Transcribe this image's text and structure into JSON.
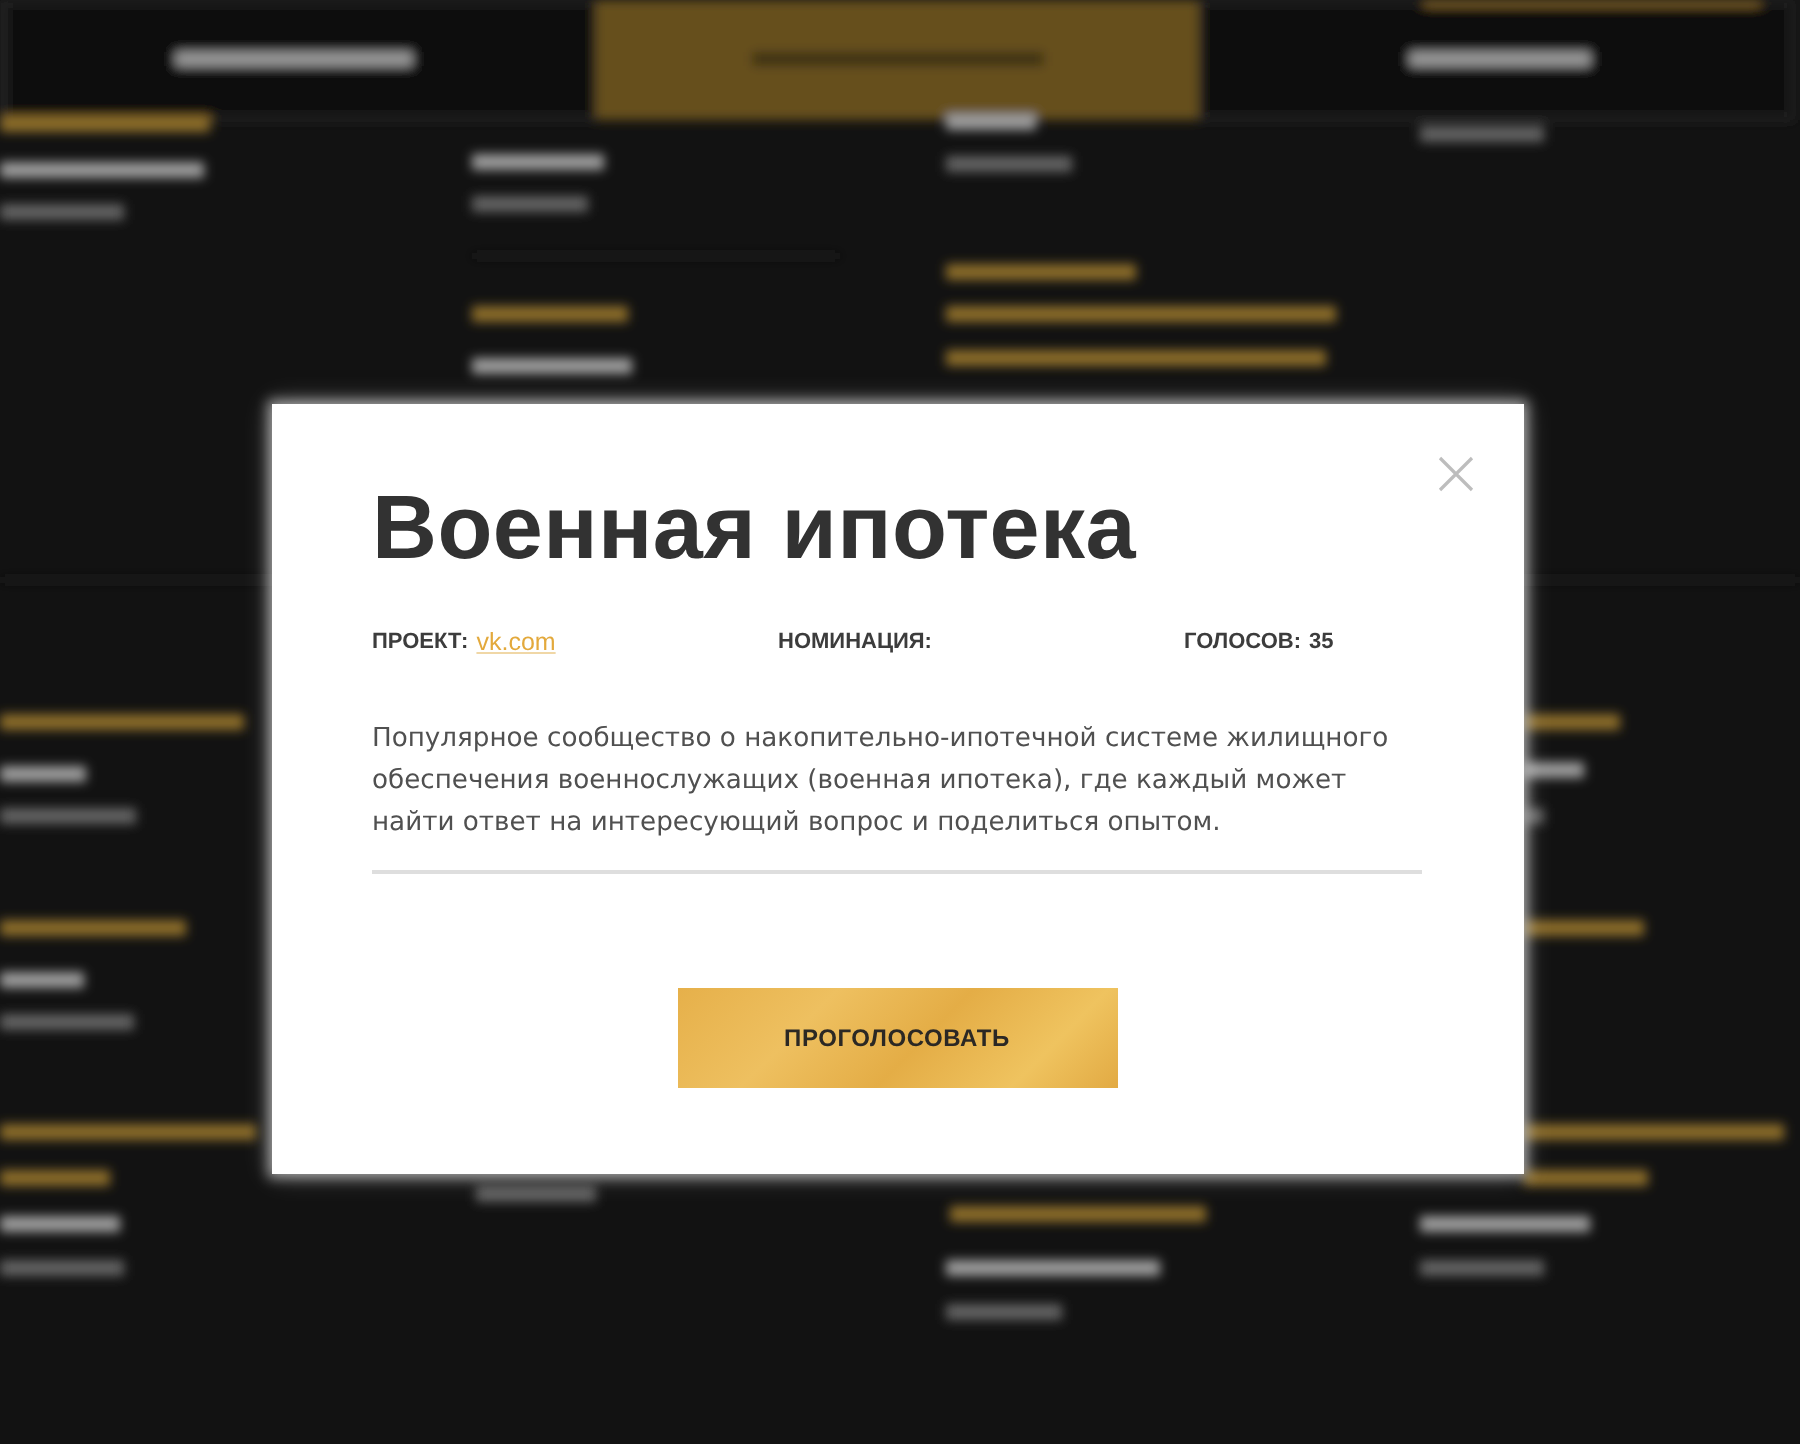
{
  "modal": {
    "title": "Военная ипотека",
    "meta": [
      {
        "kind": "link",
        "label": "ПРОЕКТ:",
        "value": "vk.com"
      },
      {
        "kind": "text",
        "label": "НОМИНАЦИЯ:"
      },
      {
        "kind": "text",
        "label": "ГОЛОСОВ:",
        "value": "35"
      }
    ],
    "description": "Популярное сообщество о накопительно-ипотечной системе жилищного обеспечения военнослужащих (военная ипотека), где каждый может найти ответ на интересующий вопрос и поделиться опытом.",
    "vote_button": "ПРОГОЛОСОВАТЬ"
  }
}
